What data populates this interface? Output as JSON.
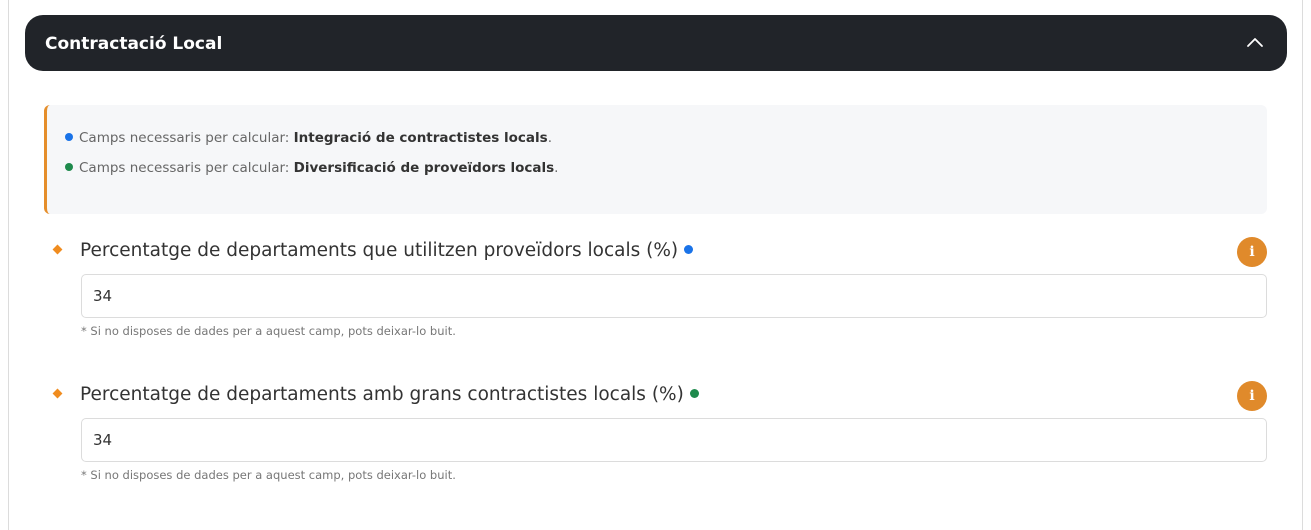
{
  "section": {
    "title": "Contractació Local",
    "collapse_icon": "chevron-up-icon"
  },
  "notice": {
    "items": [
      {
        "dot_color": "#1a73e8",
        "prefix": "Camps necessaris per calcular: ",
        "metric": "Integració de contractistes locals",
        "suffix": "."
      },
      {
        "dot_color": "#1e8a4c",
        "prefix": "Camps necessaris per calcular: ",
        "metric": "Diversificació de proveïdors locals",
        "suffix": "."
      }
    ],
    "accent_color": "#e58e2b"
  },
  "fields": [
    {
      "label": "Percentatge de departaments que utilitzen proveïdors locals (%)",
      "dot_color": "#1a73e8",
      "value": "34",
      "hint": "* Si no disposes de dades per a aquest camp, pots deixar-lo buit.",
      "info_icon": "info-icon"
    },
    {
      "label": "Percentatge de departaments amb grans contractistes locals (%)",
      "dot_color": "#1e8a4c",
      "value": "34",
      "hint": "* Si no disposes de dades per a aquest camp, pots deixar-lo buit.",
      "info_icon": "info-icon"
    }
  ],
  "colors": {
    "header_bg": "#212429",
    "required_marker": "#f08c1f",
    "info_button": "#e08a2b"
  }
}
